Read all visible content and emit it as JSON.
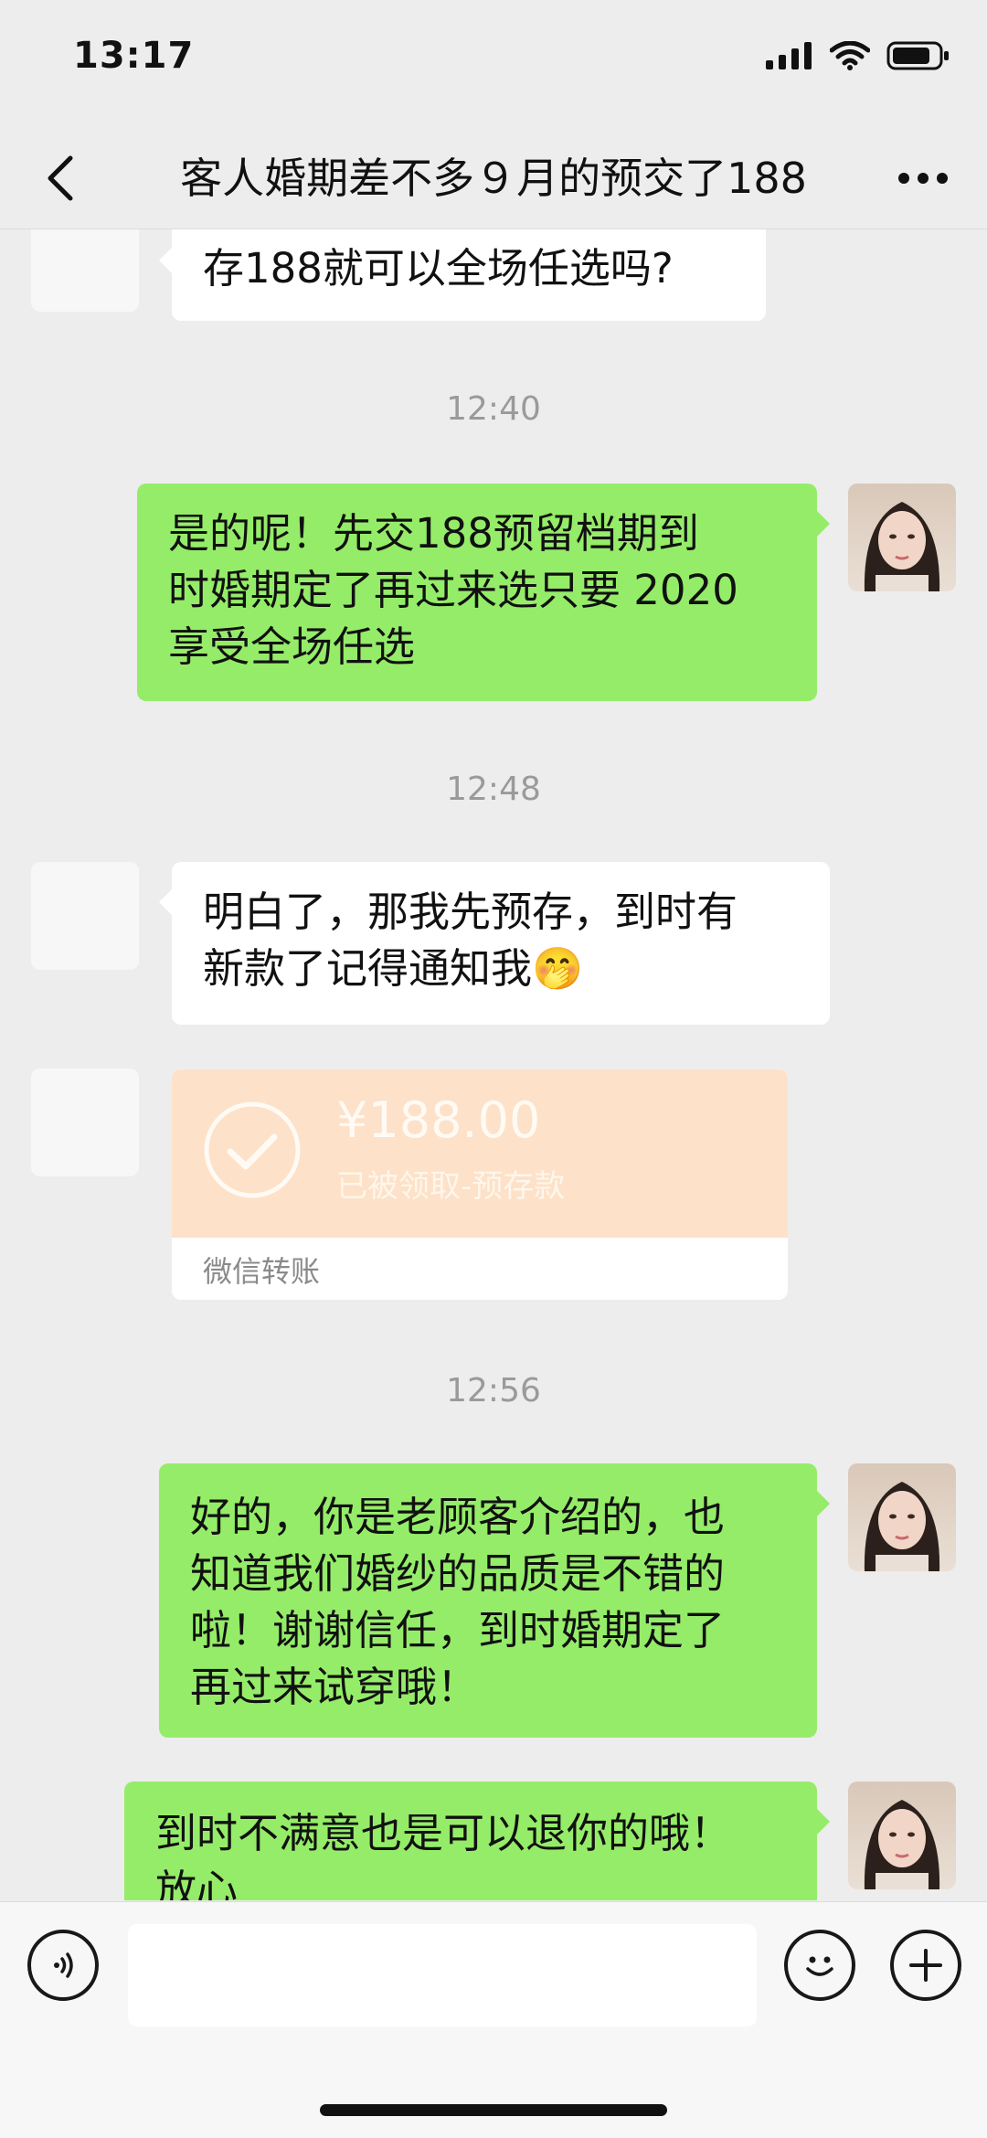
{
  "status": {
    "time": "13:17"
  },
  "nav": {
    "title": "客人婚期差不多９月的预交了188"
  },
  "messages": {
    "m1": "存188就可以全场任选吗?",
    "t1": "12:40",
    "m2_l1": "是的呢！先交188预留档期到",
    "m2_l2": "时婚期定了再过来选只要 2020",
    "m2_l3": "享受全场任选",
    "t2": "12:48",
    "m3_l1": "明白了，那我先预存，到时有",
    "m3_l2": "新款了记得通知我🤭",
    "transfer": {
      "amount": "¥188.00",
      "status": "已被领取-预存款",
      "footer": "微信转账"
    },
    "t3": "12:56",
    "m4_l1": "好的，你是老顾客介绍的，也",
    "m4_l2": "知道我们婚纱的品质是不错的",
    "m4_l3": "啦！谢谢信任，到时婚期定了",
    "m4_l4": "再过来试穿哦！",
    "m5_l1": "到时不满意也是可以退你的哦！",
    "m5_l2": "放心"
  },
  "colors": {
    "outgoing": "#95ec69",
    "incoming": "#ffffff",
    "background": "#ededed",
    "transfer": "#fde1c8"
  },
  "icons": [
    "signal-icon",
    "wifi-icon",
    "battery-icon",
    "back-icon",
    "more-icon",
    "voice-icon",
    "emoji-icon",
    "plus-icon",
    "check-circle-icon"
  ]
}
